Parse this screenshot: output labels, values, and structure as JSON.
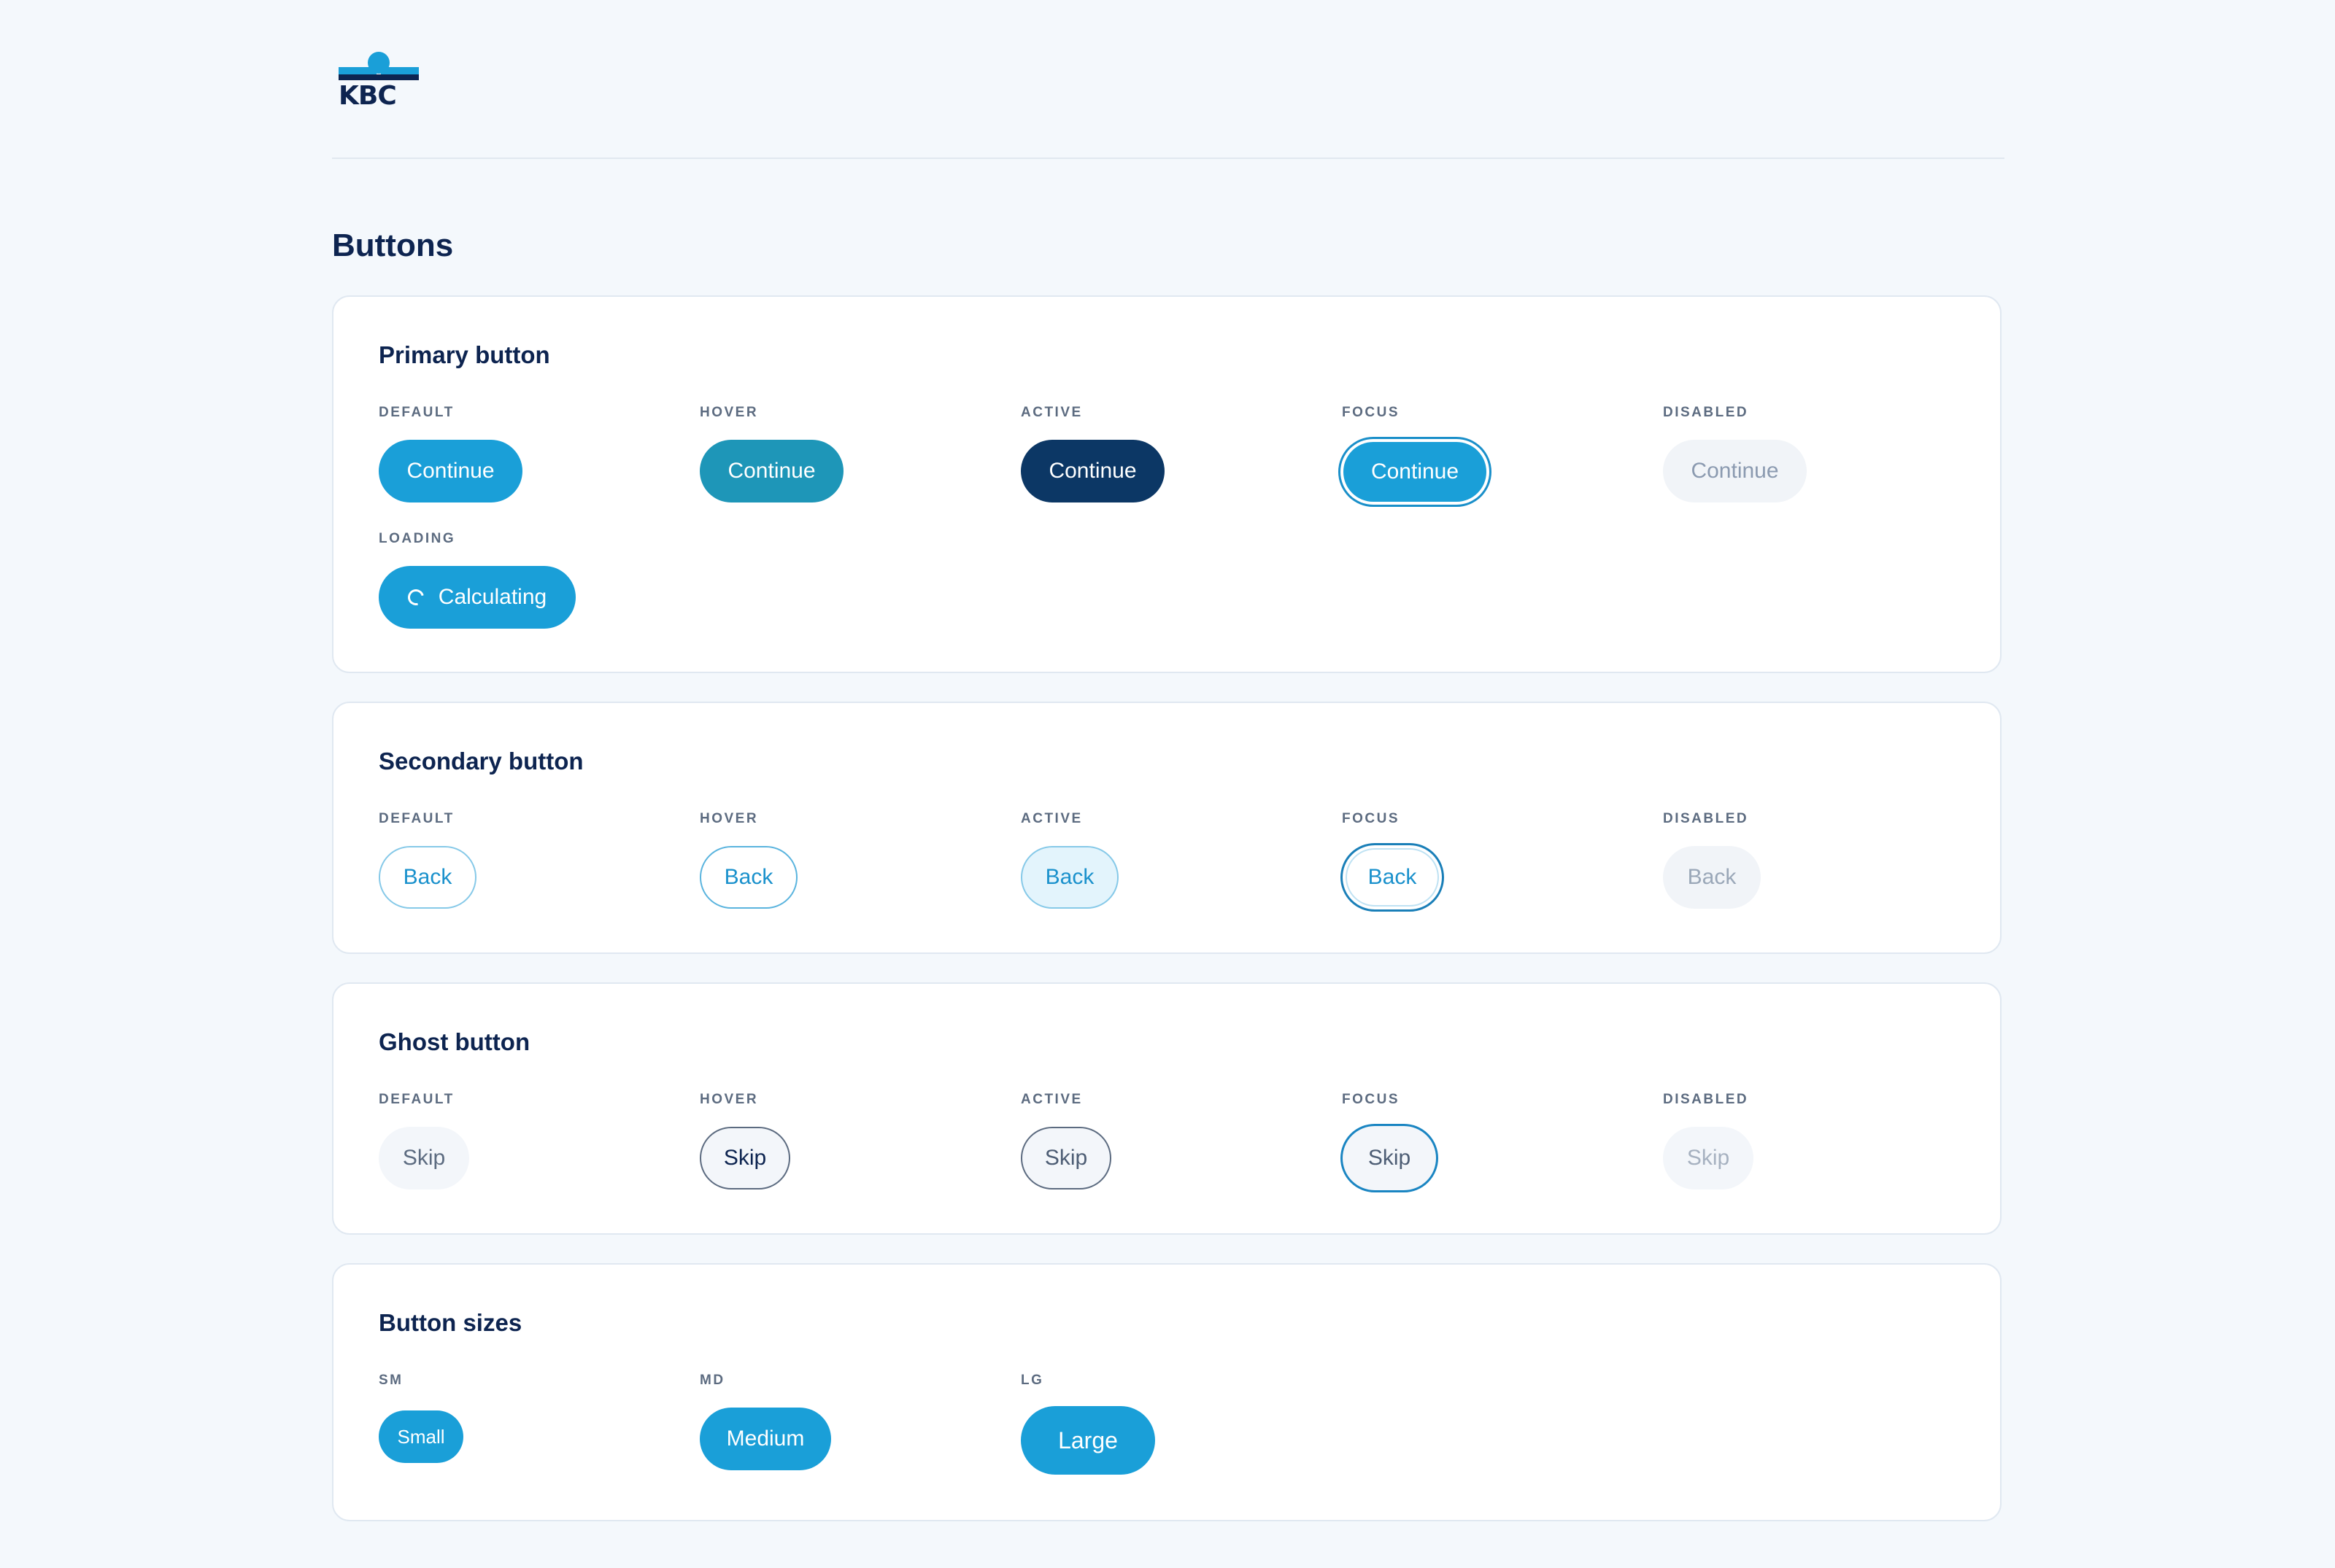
{
  "header": {
    "logo_text": "KBC"
  },
  "page_title": "Buttons",
  "primary": {
    "title": "Primary button",
    "states": [
      "DEFAULT",
      "HOVER",
      "ACTIVE",
      "FOCUS",
      "DISABLED"
    ],
    "label": "Continue",
    "loading_state": "LOADING",
    "loading_label": "Calculating"
  },
  "secondary": {
    "title": "Secondary button",
    "states": [
      "DEFAULT",
      "HOVER",
      "ACTIVE",
      "FOCUS",
      "DISABLED"
    ],
    "label": "Back"
  },
  "ghost": {
    "title": "Ghost button",
    "states": [
      "DEFAULT",
      "HOVER",
      "ACTIVE",
      "FOCUS",
      "DISABLED"
    ],
    "label": "Skip"
  },
  "sizes": {
    "title": "Button sizes",
    "states": [
      "SM",
      "MD",
      "LG"
    ],
    "labels": [
      "Small",
      "Medium",
      "Large"
    ]
  },
  "colors": {
    "primary": "#1a9fd8",
    "primary_hover": "#1e96b8",
    "primary_active": "#0c3765",
    "text_dark": "#0d2450",
    "background": "#f4f8fc"
  },
  "icons": {
    "loading": "spinner-icon"
  }
}
